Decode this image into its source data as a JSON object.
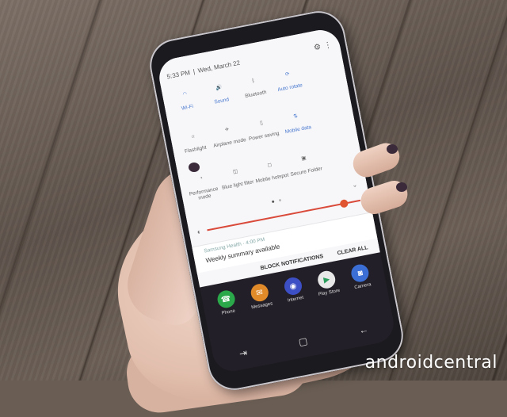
{
  "status": {
    "time": "5:33 PM",
    "date": "Wed, March 22",
    "settings_icon": "gear-icon",
    "more_icon": "more-vertical-icon"
  },
  "quick_settings": [
    {
      "label": "Wi-Fi",
      "icon": "wifi-icon",
      "active": true
    },
    {
      "label": "Sound",
      "icon": "sound-icon",
      "active": true
    },
    {
      "label": "Bluetooth",
      "icon": "bluetooth-icon",
      "active": false
    },
    {
      "label": "Auto rotate",
      "icon": "rotate-icon",
      "active": true
    },
    {
      "label": "",
      "icon": "",
      "active": false
    },
    {
      "label": "Flashlight",
      "icon": "flashlight-icon",
      "active": false
    },
    {
      "label": "Airplane mode",
      "icon": "airplane-icon",
      "active": false
    },
    {
      "label": "Power saving",
      "icon": "battery-icon",
      "active": false
    },
    {
      "label": "Mobile data",
      "icon": "mobile-data-icon",
      "active": true
    },
    {
      "label": "",
      "icon": "",
      "active": false
    },
    {
      "label": "Performance mode",
      "icon": "speedometer-icon",
      "active": false
    },
    {
      "label": "Blue light filter",
      "icon": "blue-light-icon",
      "active": false
    },
    {
      "label": "Mobile hotspot",
      "icon": "hotspot-icon",
      "active": false
    },
    {
      "label": "Secure Folder",
      "icon": "secure-folder-icon",
      "active": false
    },
    {
      "label": "",
      "icon": "",
      "active": false
    }
  ],
  "brightness": {
    "level": 0.9,
    "accent": "#e0552f"
  },
  "notification": {
    "source": "Samsung Health · 4:00 PM",
    "message": "Weekly summary available"
  },
  "actions": {
    "block": "BLOCK NOTIFICATIONS",
    "clear": "CLEAR ALL"
  },
  "apps": [
    {
      "label": "Phone",
      "color": "#2aa84a",
      "icon": "phone-icon"
    },
    {
      "label": "Messages",
      "color": "#e08a2a",
      "icon": "messages-icon"
    },
    {
      "label": "Internet",
      "color": "#3d4fc4",
      "icon": "internet-icon"
    },
    {
      "label": "Play Store",
      "color": "#e8e8e8",
      "icon": "play-store-icon"
    },
    {
      "label": "Camera",
      "color": "#3b6fd6",
      "icon": "camera-icon"
    }
  ],
  "watermark": "androidcentral"
}
